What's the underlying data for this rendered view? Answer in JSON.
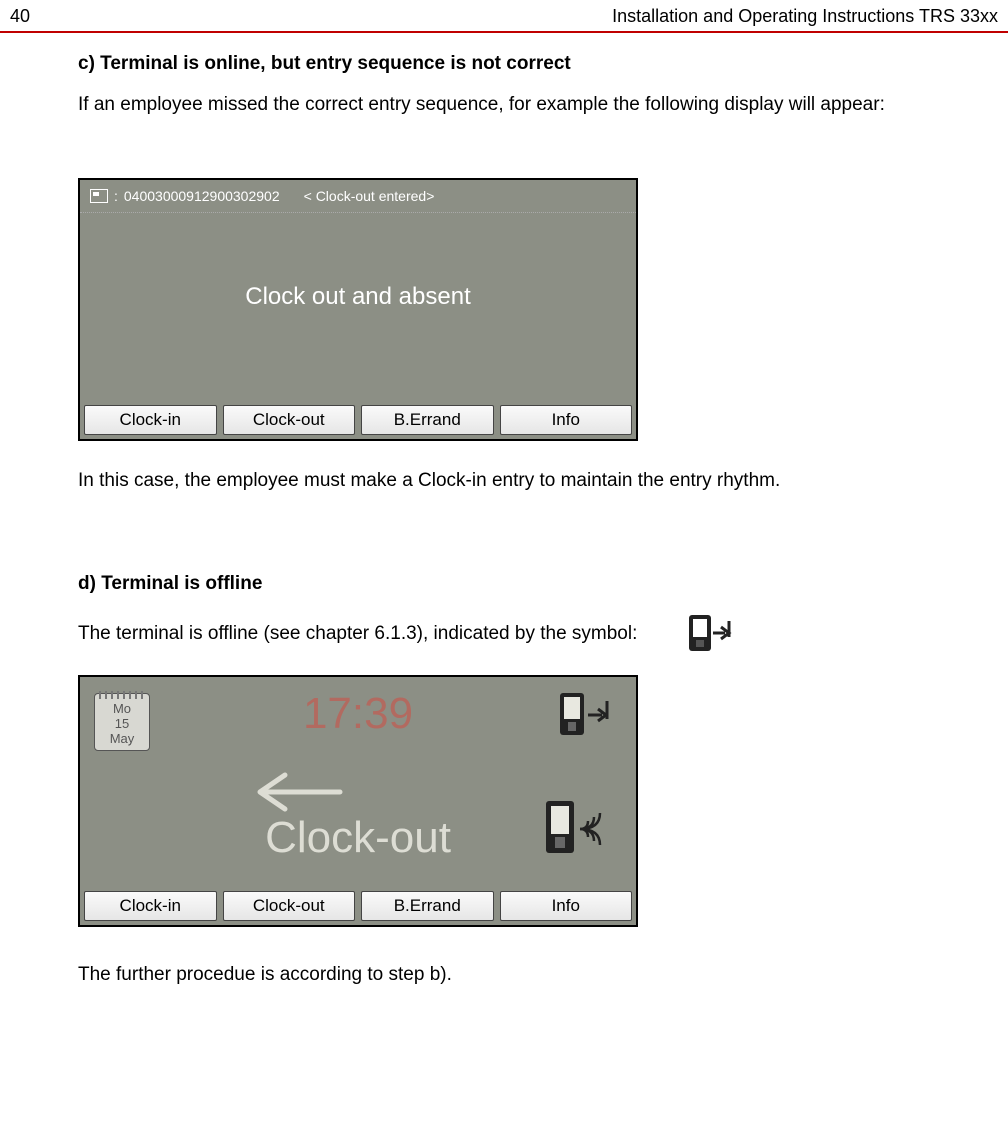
{
  "header": {
    "page_number": "40",
    "doc_title": "Installation  and Operating Instructions TRS 33xx"
  },
  "section_c": {
    "heading": "c) Terminal is online, but entry sequence is not correct",
    "intro": "If an employee missed the correct entry sequence, for example the following display will appear:",
    "after": "In this case, the employee must make a Clock-in entry to maintain the entry rhythm."
  },
  "screen1": {
    "id_prefix": ":",
    "card_id": "04003000912900302902",
    "status": "< Clock-out entered>",
    "message": "Clock out and absent",
    "buttons": [
      "Clock-in",
      "Clock-out",
      "B.Errand",
      "Info"
    ]
  },
  "section_d": {
    "heading": "d) Terminal is offline",
    "intro": "The terminal is offline (see chapter 6.1.3), indicated by the symbol:",
    "after": "The further procedue is according to step b)."
  },
  "screen2": {
    "date": {
      "dow": "Mo",
      "day": "15",
      "month": "May"
    },
    "time": "17:39",
    "mode": "Clock-out",
    "buttons": [
      "Clock-in",
      "Clock-out",
      "B.Errand",
      "Info"
    ]
  }
}
